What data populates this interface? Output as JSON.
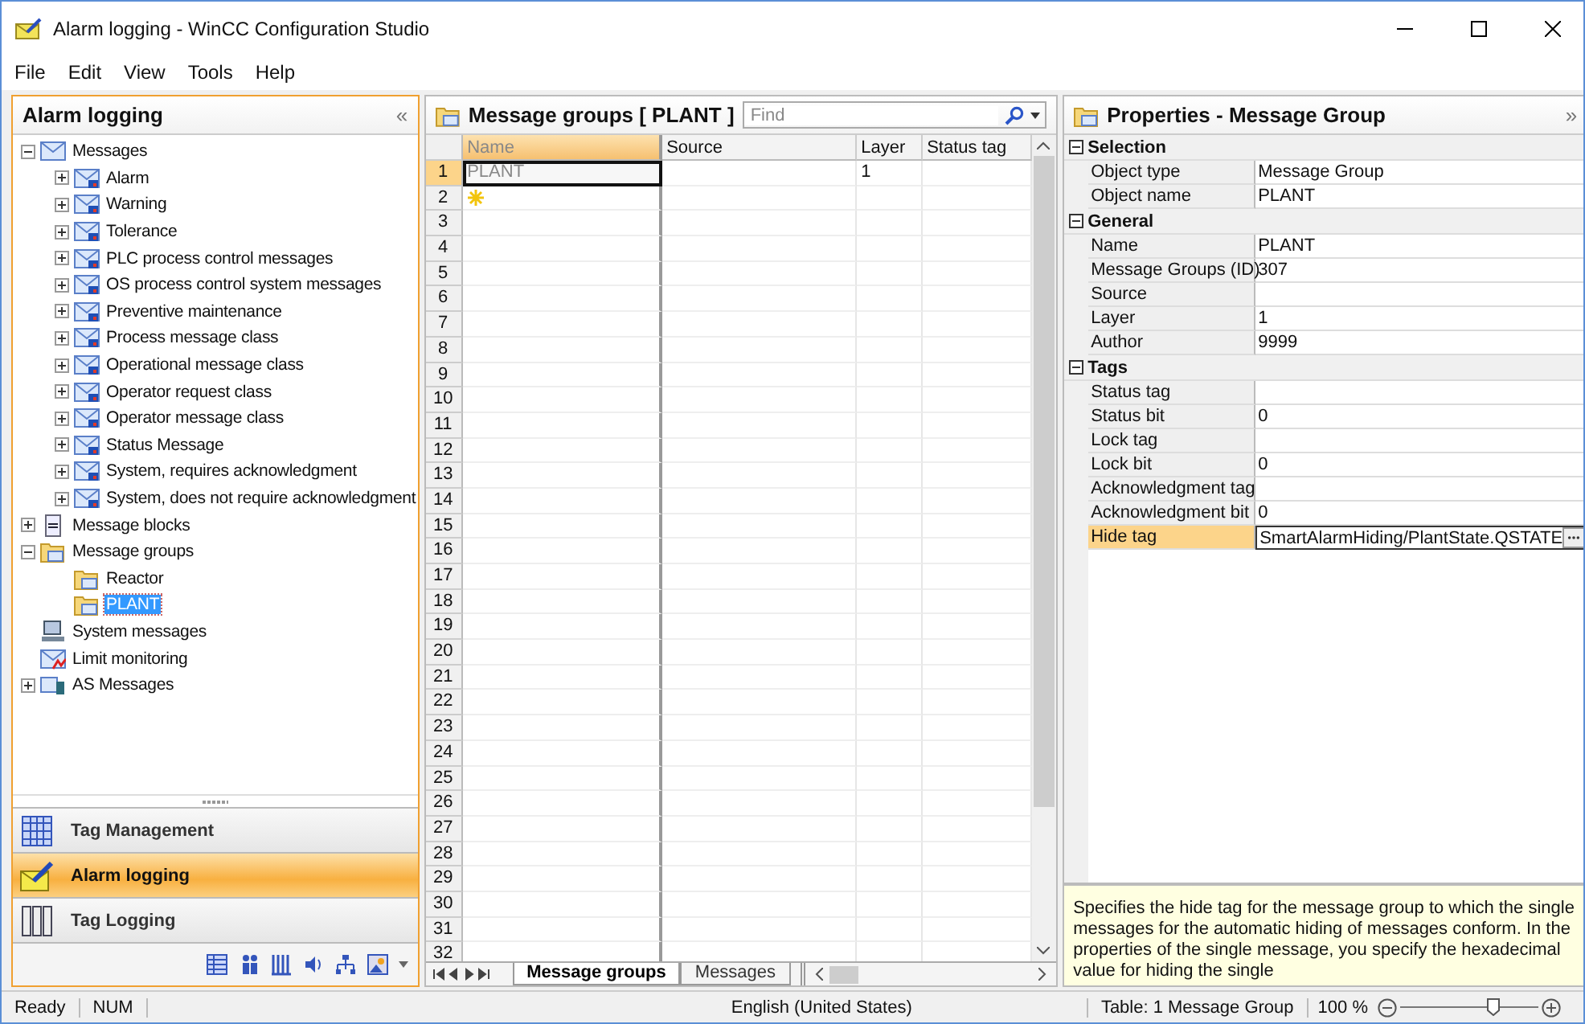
{
  "window": {
    "title": "Alarm logging - WinCC Configuration Studio"
  },
  "menu": [
    {
      "label": "File"
    },
    {
      "label": "Edit"
    },
    {
      "label": "View"
    },
    {
      "label": "Tools"
    },
    {
      "label": "Help"
    }
  ],
  "navigation": {
    "title": "Alarm logging",
    "collapse": "«",
    "tree": [
      {
        "label": "Messages",
        "kind": "envelope",
        "expanded": true,
        "selected": false,
        "children": [
          {
            "label": "Alarm",
            "kind": "message-class",
            "expanded": false,
            "selected": false
          },
          {
            "label": "Warning",
            "kind": "message-class",
            "expanded": false,
            "selected": false
          },
          {
            "label": "Tolerance",
            "kind": "message-class",
            "expanded": false,
            "selected": false
          },
          {
            "label": "PLC process control messages",
            "kind": "message-class",
            "expanded": false,
            "selected": false
          },
          {
            "label": "OS process control system messages",
            "kind": "message-class",
            "expanded": false,
            "selected": false
          },
          {
            "label": "Preventive maintenance",
            "kind": "message-class",
            "expanded": false,
            "selected": false
          },
          {
            "label": "Process message class",
            "kind": "message-class",
            "expanded": false,
            "selected": false
          },
          {
            "label": "Operational message class",
            "kind": "message-class",
            "expanded": false,
            "selected": false
          },
          {
            "label": "Operator request class",
            "kind": "message-class",
            "expanded": false,
            "selected": false
          },
          {
            "label": "Operator message class",
            "kind": "message-class",
            "expanded": false,
            "selected": false
          },
          {
            "label": "Status Message",
            "kind": "message-class",
            "expanded": false,
            "selected": false
          },
          {
            "label": "System, requires acknowledgment",
            "kind": "message-class",
            "expanded": false,
            "selected": false
          },
          {
            "label": "System, does not require acknowledgment",
            "kind": "message-class",
            "expanded": false,
            "selected": false
          }
        ]
      },
      {
        "label": "Message blocks",
        "kind": "blocks",
        "expanded": false,
        "selected": false
      },
      {
        "label": "Message groups",
        "kind": "folder",
        "expanded": true,
        "selected": false,
        "children": [
          {
            "label": "Reactor",
            "kind": "folder",
            "selected": false
          },
          {
            "label": "PLANT",
            "kind": "folder",
            "selected": true
          }
        ]
      },
      {
        "label": "System messages",
        "kind": "system",
        "selected": false
      },
      {
        "label": "Limit monitoring",
        "kind": "limit",
        "selected": false
      },
      {
        "label": "AS Messages",
        "kind": "plc",
        "expanded": false,
        "selected": false
      }
    ],
    "editors": [
      {
        "label": "Tag Management",
        "kind": "tags",
        "selected": false
      },
      {
        "label": "Alarm logging",
        "kind": "alarm",
        "selected": true
      },
      {
        "label": "Tag Logging",
        "kind": "logging",
        "selected": false
      }
    ]
  },
  "table": {
    "title": "Message groups [ PLANT ]",
    "search": {
      "placeholder": "Find"
    },
    "columns": [
      "Name",
      "Source",
      "Layer",
      "Status tag"
    ],
    "rows": [
      {
        "number": "1",
        "name": "PLANT",
        "layer": "1",
        "selected": true
      },
      {
        "number": "2",
        "kind": "new",
        "selected": false
      },
      {
        "number": "3",
        "selected": false
      },
      {
        "number": "4",
        "selected": false
      },
      {
        "number": "5",
        "selected": false
      },
      {
        "number": "6",
        "selected": false
      },
      {
        "number": "7",
        "selected": false
      },
      {
        "number": "8",
        "selected": false
      },
      {
        "number": "9",
        "selected": false
      },
      {
        "number": "10",
        "selected": false
      },
      {
        "number": "11",
        "selected": false
      },
      {
        "number": "12",
        "selected": false
      },
      {
        "number": "13",
        "selected": false
      },
      {
        "number": "14",
        "selected": false
      },
      {
        "number": "15",
        "selected": false
      },
      {
        "number": "16",
        "selected": false
      },
      {
        "number": "17",
        "selected": false
      },
      {
        "number": "18",
        "selected": false
      },
      {
        "number": "19",
        "selected": false
      },
      {
        "number": "20",
        "selected": false
      },
      {
        "number": "21",
        "selected": false
      },
      {
        "number": "22",
        "selected": false
      },
      {
        "number": "23",
        "selected": false
      },
      {
        "number": "24",
        "selected": false
      },
      {
        "number": "25",
        "selected": false
      },
      {
        "number": "26",
        "selected": false
      },
      {
        "number": "27",
        "selected": false
      },
      {
        "number": "28",
        "selected": false
      },
      {
        "number": "29",
        "selected": false
      },
      {
        "number": "30",
        "selected": false
      },
      {
        "number": "31",
        "selected": false
      },
      {
        "number": "32",
        "selected": false
      }
    ],
    "sheet_tabs": [
      {
        "label": "Message groups",
        "selected": true
      },
      {
        "label": "Messages",
        "selected": false
      }
    ]
  },
  "properties": {
    "title": "Properties - Message Group",
    "collapse": "»",
    "sections": [
      {
        "title": "Selection",
        "expanded": true,
        "rows": [
          {
            "label": "Object type",
            "value": "Message Group",
            "selected": false
          },
          {
            "label": "Object name",
            "value": "PLANT",
            "selected": false
          }
        ]
      },
      {
        "title": "General",
        "expanded": true,
        "rows": [
          {
            "label": "Name",
            "value": "PLANT",
            "selected": false
          },
          {
            "label": "Message Groups (ID)",
            "value": "307",
            "selected": false
          },
          {
            "label": "Source",
            "selected": false
          },
          {
            "label": "Layer",
            "value": "1",
            "selected": false
          },
          {
            "label": "Author",
            "value": "9999",
            "selected": false
          }
        ]
      },
      {
        "title": "Tags",
        "expanded": true,
        "rows": [
          {
            "label": "Status tag",
            "selected": false
          },
          {
            "label": "Status bit",
            "value": "0",
            "selected": false
          },
          {
            "label": "Lock tag",
            "selected": false
          },
          {
            "label": "Lock bit",
            "value": "0",
            "selected": false
          },
          {
            "label": "Acknowledgment tag",
            "selected": false
          },
          {
            "label": "Acknowledgment bit",
            "value": "0",
            "selected": false
          },
          {
            "label": "Hide tag",
            "value": "SmartAlarmHiding/PlantState.QSTATE",
            "selected": true
          }
        ]
      }
    ],
    "description": "Specifies the hide tag for the message group to which the single messages for the automatic hiding of messages conform. In the properties of the single message, you specify the hexadecimal value for hiding the single"
  },
  "status_bar": {
    "state": "Ready",
    "num": "NUM",
    "language": "English (United States)",
    "summary": "Table: 1 Message Group",
    "zoom": "100 %",
    "zoom_slider": {
      "level": 0.68
    }
  }
}
